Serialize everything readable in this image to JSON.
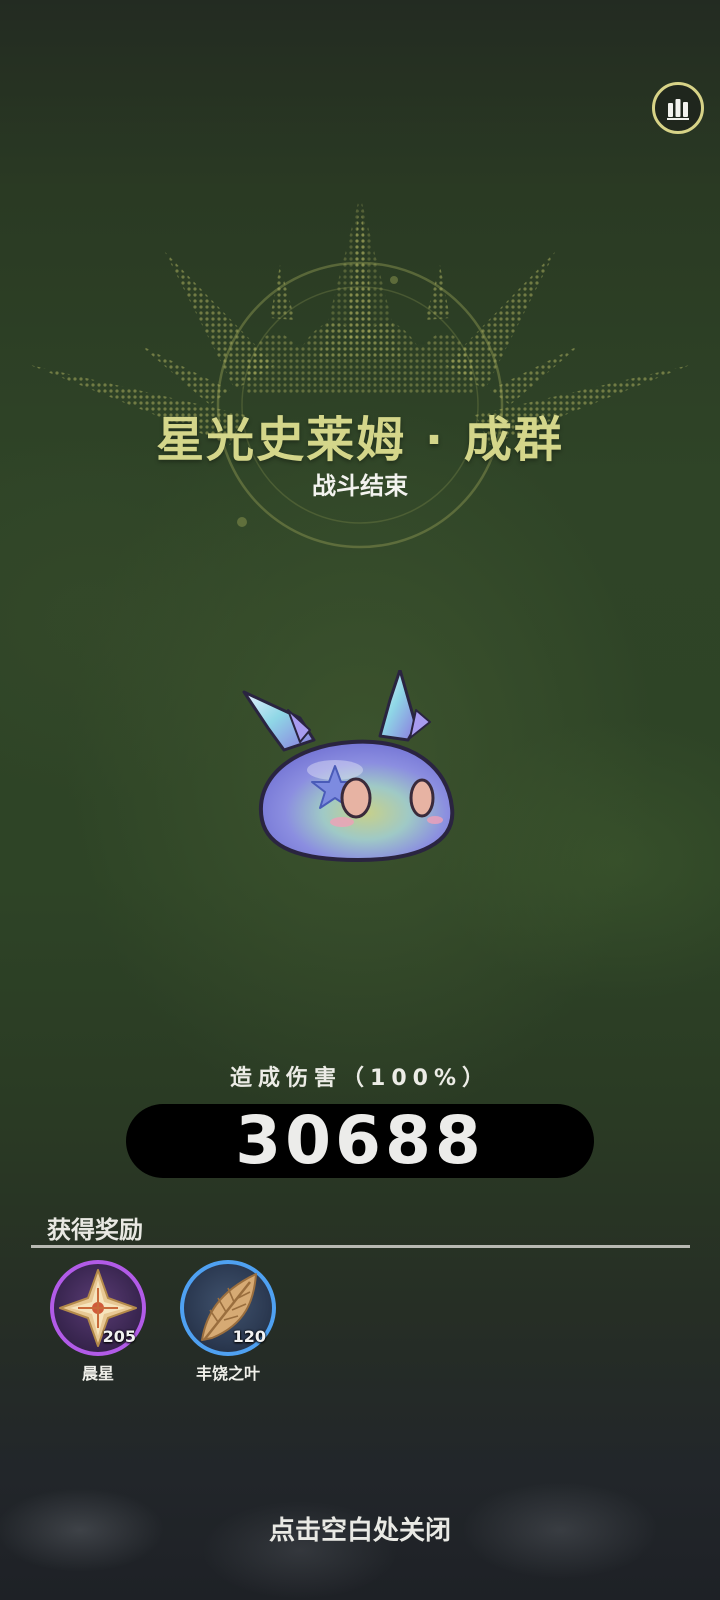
{
  "header": {
    "stats_icon": "bar-chart-icon"
  },
  "boss": {
    "title": "星光史莱姆 · 成群",
    "status": "战斗结束",
    "image_icon": "starlight-slime-illustration"
  },
  "damage": {
    "label": "造成伤害（100%）",
    "value": "30688"
  },
  "rewards": {
    "title": "获得奖励",
    "items": [
      {
        "name": "晨星",
        "count": "205",
        "icon": "morning-star-icon",
        "rarity_color": "#b25be8"
      },
      {
        "name": "丰饶之叶",
        "count": "120",
        "icon": "leaf-icon",
        "rarity_color": "#4fa1f2"
      }
    ]
  },
  "footer": {
    "close_hint": "点击空白处关闭"
  },
  "colors": {
    "title_accent": "#d4d68a",
    "damage_bar": "#000000"
  }
}
